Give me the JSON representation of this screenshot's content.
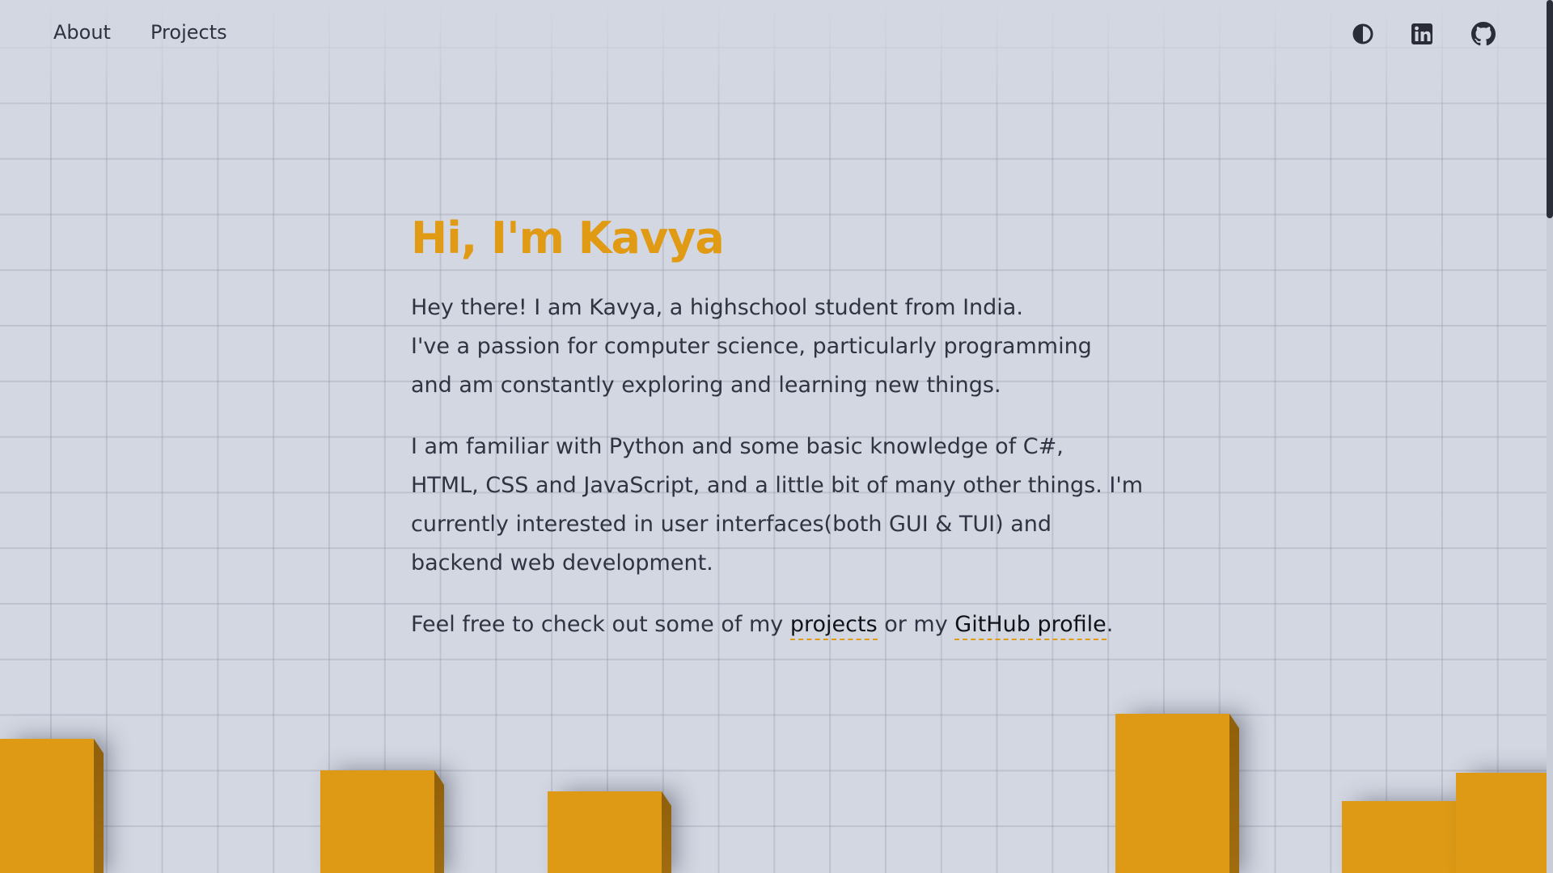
{
  "nav": {
    "about_label": "About",
    "projects_label": "Projects"
  },
  "icons": {
    "theme": "half-circle-theme-icon",
    "linkedin": "linkedin-icon",
    "github": "github-icon"
  },
  "hero": {
    "title": "Hi, I'm Kavya",
    "intro_line1": "Hey there! I am Kavya, a highschool student from India.",
    "intro_line2": "I've a passion for computer science, particularly programming",
    "intro_line3": "and am constantly exploring and learning new things.",
    "skills_line1": "I am familiar with Python and some basic knowledge of C#,",
    "skills_line2": "HTML, CSS and JavaScript, and a little bit of many other things. I'm",
    "skills_line3": "currently interested in user interfaces(both GUI & TUI) and",
    "skills_line4": "backend web development.",
    "cta_prefix": "Feel free to check out some of my ",
    "cta_projects_link": "projects",
    "cta_middle": " or my ",
    "cta_github_link": "GitHub profile",
    "cta_suffix": "."
  },
  "colors": {
    "accent": "#e09a14",
    "background": "#d3d7e2",
    "text": "#2f3342"
  }
}
